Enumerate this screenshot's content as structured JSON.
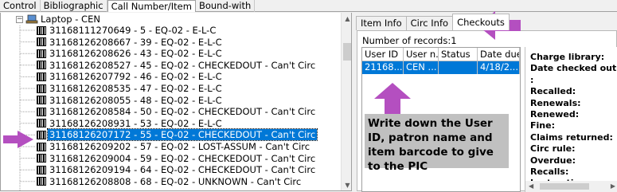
{
  "top_tabs": [
    "Control",
    "Bibliographic",
    "Call Number/Item",
    "Bound-with"
  ],
  "active_top_tab": 2,
  "tree": {
    "root_label": "Laptop - CEN",
    "items": [
      "31168111270649 - 5 - EQ-02 - E-L-C",
      "31168126208667 - 39 - EQ-02 - E-L-C",
      "31168126208626 - 43 - EQ-02 - E-L-C",
      "31168126208527 - 45 - EQ-02 - CHECKEDOUT - Can't Circ",
      "31168126207792 - 46 - EQ-02 - E-L-C",
      "31168126208535 - 47 - EQ-02 - E-L-C",
      "31168126208055 - 48 - EQ-02 - E-L-C",
      "31168126208584 - 50 - EQ-02 - CHECKEDOUT - Can't Circ",
      "31168126208931 - 53 - EQ-02 - E-L-C",
      "31168126207172 - 55 - EQ-02 - CHECKEDOUT - Can't Circ",
      "31168126209202 - 57 - EQ-02 - LOST-ASSUM - Can't Circ",
      "31168126209004 - 59 - EQ-02 - CHECKEDOUT - Can't Circ",
      "31168126209194 - 64 - EQ-02 - CHECKEDOUT - Can't Circ",
      "31168126208808 - 68 - EQ-02 - UNKNOWN - Can't Circ"
    ],
    "selected_index": 9
  },
  "detail_tabs": [
    "Item Info",
    "Circ Info",
    "Checkouts"
  ],
  "active_detail_tab": 2,
  "checkouts": {
    "records_label": "Number of records:1",
    "columns": [
      "User ID",
      "User n...",
      "Status",
      "Date due"
    ],
    "rows": [
      [
        "21168...",
        "CEN ...",
        "",
        "4/18/2..."
      ]
    ]
  },
  "info_fields": [
    "Charge library:",
    "Date checked out:",
    ":",
    "Recalled:",
    "Renewals:",
    "Renewed:",
    "Fine:",
    "Claims returned:",
    "Circ rule:",
    "Overdue:",
    "Recalls:",
    "Last notice:"
  ],
  "callout_text": "Write down the User ID, patron name and item barcode to give to the PIC",
  "colors": {
    "accent": "#0078d7",
    "arrow": "#b44fc0",
    "callout_bg": "#c0c0c0"
  }
}
